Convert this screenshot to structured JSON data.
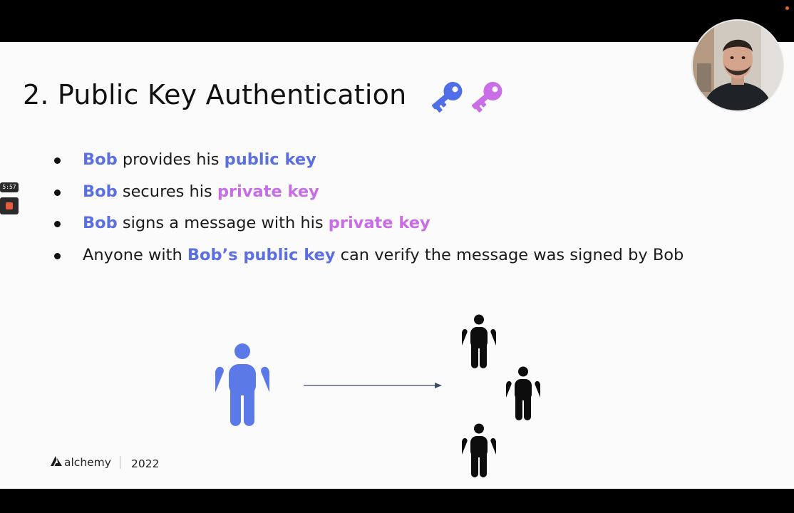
{
  "slide": {
    "title": "2. Public Key Authentication",
    "bullets": [
      {
        "parts": [
          {
            "text": "Bob",
            "style": "blue"
          },
          {
            "text": " provides his ",
            "style": "plain"
          },
          {
            "text": "public key",
            "style": "blue"
          }
        ]
      },
      {
        "parts": [
          {
            "text": "Bob",
            "style": "blue"
          },
          {
            "text": " secures his ",
            "style": "plain"
          },
          {
            "text": "private key",
            "style": "purple"
          }
        ]
      },
      {
        "parts": [
          {
            "text": "Bob",
            "style": "blue"
          },
          {
            "text": " signs a message with his ",
            "style": "plain"
          },
          {
            "text": "private key",
            "style": "purple"
          }
        ]
      },
      {
        "parts": [
          {
            "text": "Anyone with ",
            "style": "plain"
          },
          {
            "text": "Bob’s public key",
            "style": "blue"
          },
          {
            "text": " can verify the message was signed by Bob",
            "style": "plain"
          }
        ]
      }
    ],
    "footer": {
      "brand": "alchemy",
      "year": "2022"
    }
  },
  "recorder": {
    "timer": "5:57"
  },
  "icons": [
    "key-icon",
    "key-icon",
    "person-icon",
    "arrow-icon",
    "alchemy-logo-icon",
    "stop-icon"
  ],
  "colors": {
    "blue": "#5b6fe0",
    "purple": "#c86de6",
    "key_blue": "#4f6ee8",
    "key_purple": "#c96ee6",
    "person_blue": "#5b7ae8"
  }
}
